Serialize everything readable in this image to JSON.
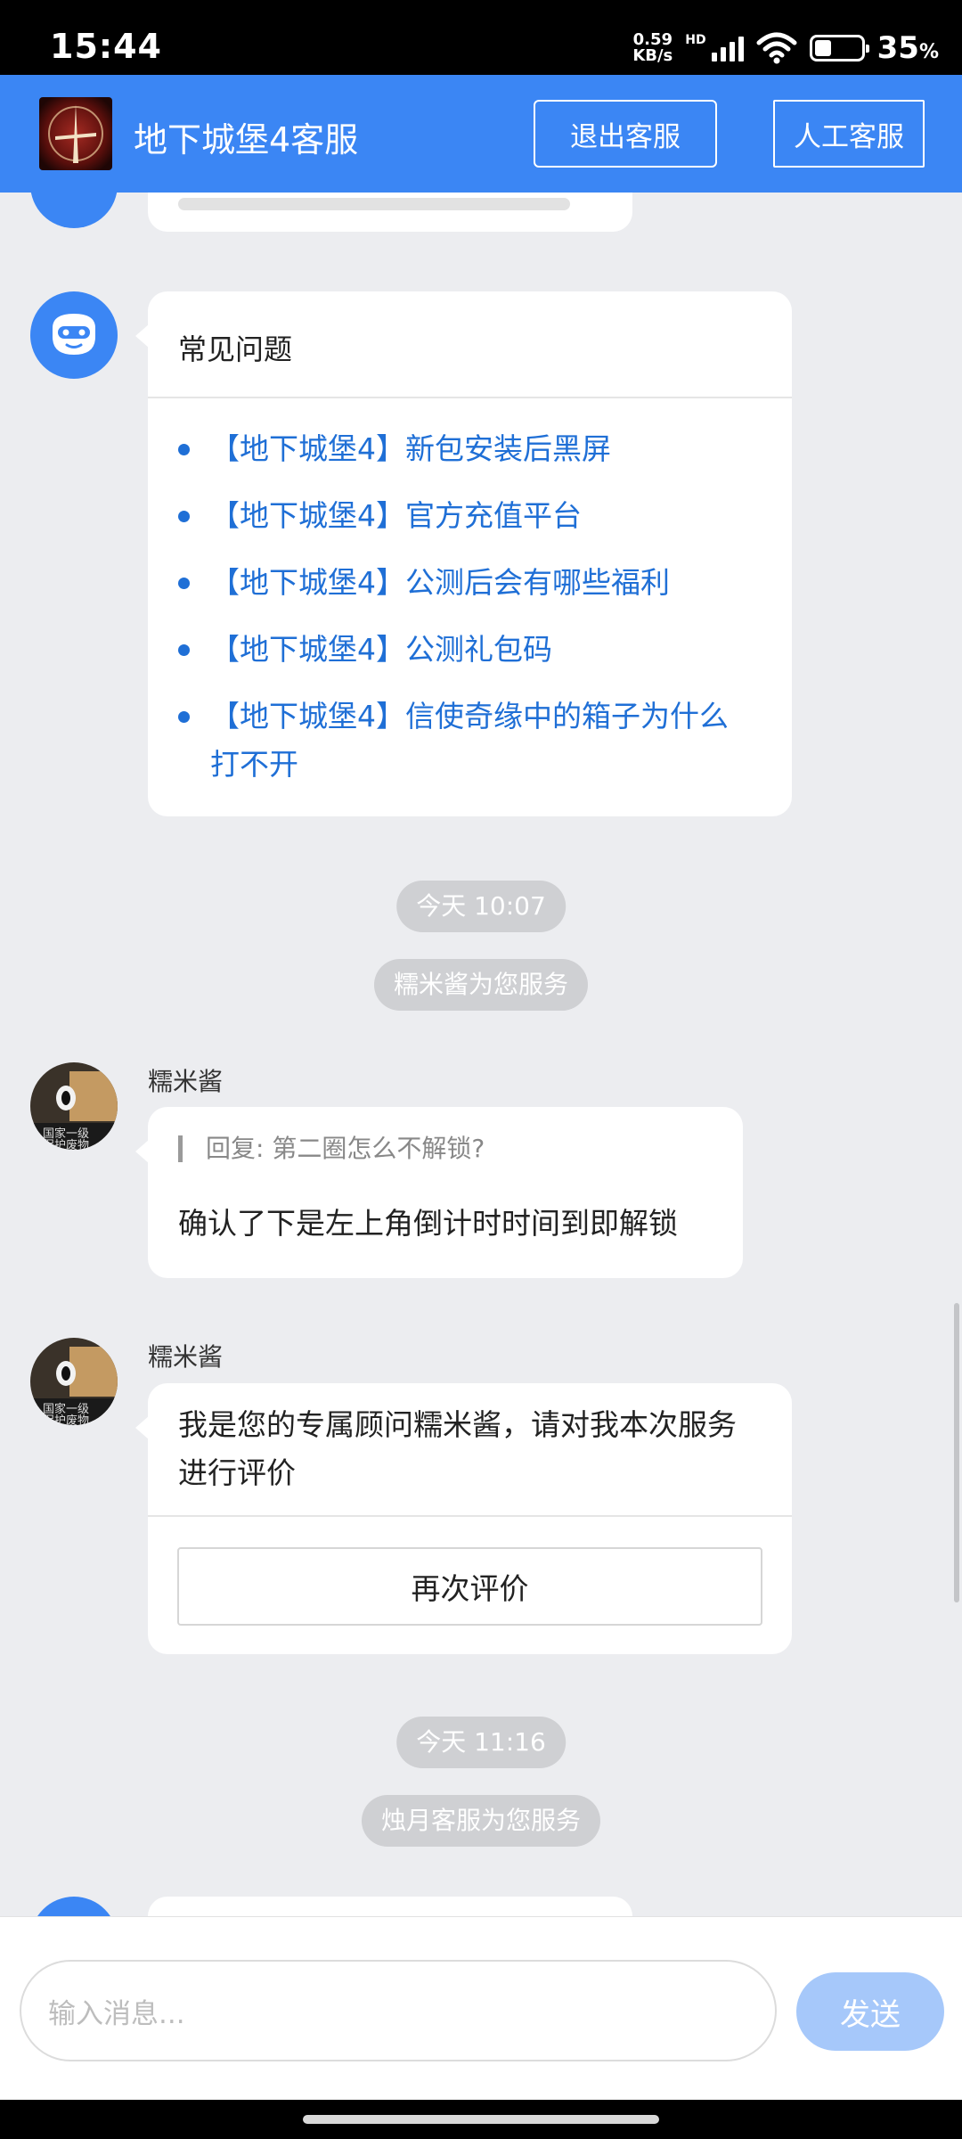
{
  "status_bar": {
    "time": "15:44",
    "net_speed_value": "0.59",
    "net_speed_unit": "KB/s",
    "hd_label": "HD",
    "battery_percent": "35",
    "battery_unit": "%",
    "battery_level": 0.35
  },
  "header": {
    "title": "地下城堡4客服",
    "exit_label": "退出客服",
    "human_label": "人工客服"
  },
  "faq": {
    "title": "常见问题",
    "items": [
      "【地下城堡4】新包安装后黑屏",
      "【地下城堡4】官方充值平台",
      "【地下城堡4】公测后会有哪些福利",
      "【地下城堡4】公测礼包码",
      "【地下城堡4】信使奇缘中的箱子为什么打不开"
    ]
  },
  "session1": {
    "time_label": "今天 10:07",
    "service_label": "糯米酱为您服务"
  },
  "msg1": {
    "sender": "糯米酱",
    "quote": "回复: 第二圈怎么不解锁?",
    "text": "确认了下是左上角倒计时时间到即解锁"
  },
  "msg2": {
    "sender": "糯米酱",
    "text": "我是您的专属顾问糯米酱，请对我本次服务进行评价",
    "rate_button": "再次评价"
  },
  "session2": {
    "time_label": "今天 11:16",
    "service_label": "烛月客服为您服务"
  },
  "input": {
    "placeholder": "输入消息...",
    "send_label": "发送"
  },
  "colors": {
    "primary": "#3b86f4",
    "link": "#1f6fd6",
    "send_disabled": "#a6c8fa",
    "chat_bg": "#ecedf0"
  }
}
